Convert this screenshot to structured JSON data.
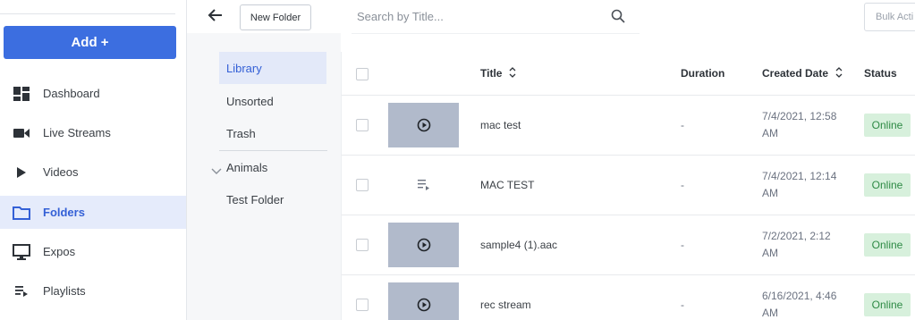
{
  "sidebar": {
    "add_label": "Add +",
    "items": [
      {
        "label": "Dashboard",
        "icon": "dashboard-icon"
      },
      {
        "label": "Live Streams",
        "icon": "video-camera-icon"
      },
      {
        "label": "Videos",
        "icon": "play-icon"
      },
      {
        "label": "Folders",
        "icon": "folder-icon",
        "active": true
      },
      {
        "label": "Expos",
        "icon": "monitor-icon"
      },
      {
        "label": "Playlists",
        "icon": "playlist-icon"
      }
    ]
  },
  "toolbar": {
    "new_folder_label": "New Folder",
    "search_placeholder": "Search by Title...",
    "bulk_label": "Bulk Acti"
  },
  "folders": {
    "items": [
      {
        "label": "Library",
        "active": true
      },
      {
        "label": "Unsorted"
      },
      {
        "label": "Trash"
      },
      {
        "label": "Animals",
        "collapsible": true
      },
      {
        "label": "Test Folder"
      }
    ]
  },
  "table": {
    "columns": {
      "title": "Title",
      "duration": "Duration",
      "created": "Created Date",
      "status": "Status"
    },
    "rows": [
      {
        "title": "mac test",
        "duration": "-",
        "created": "7/4/2021, 12:58 AM",
        "status": "Online",
        "thumb": "video"
      },
      {
        "title": "MAC TEST",
        "duration": "-",
        "created": "7/4/2021, 12:14 AM",
        "status": "Online",
        "thumb": "playlist"
      },
      {
        "title": "sample4 (1).aac",
        "duration": "-",
        "created": "7/2/2021, 2:12 AM",
        "status": "Online",
        "thumb": "video"
      },
      {
        "title": "rec stream",
        "duration": "-",
        "created": "6/16/2021, 4:46 AM",
        "status": "Online",
        "thumb": "video"
      }
    ]
  },
  "colors": {
    "accent": "#3c6ee0",
    "active_bg": "#e5ebfb",
    "online_bg": "#d7f0dc",
    "online_text": "#2e8a45",
    "thumb_bg": "#b1bacb"
  }
}
